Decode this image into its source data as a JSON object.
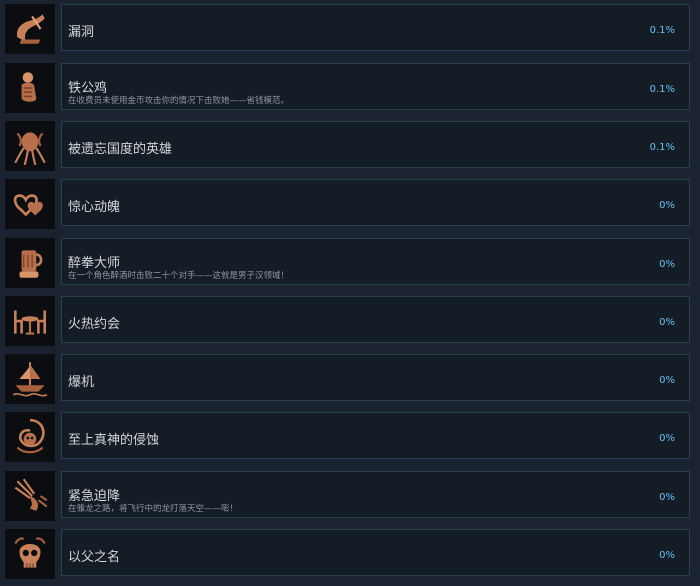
{
  "achievements": [
    {
      "title": "漏洞",
      "desc": "",
      "percent": "0.1%",
      "icon": "scroll-quill-icon"
    },
    {
      "title": "铁公鸡",
      "desc": "在收费员未使用金币攻击你的情况下击败她——省钱模范。",
      "percent": "0.1%",
      "icon": "coin-hand-icon"
    },
    {
      "title": "被遗忘国度的英雄",
      "desc": "",
      "percent": "0.1%",
      "icon": "mind-flayer-icon"
    },
    {
      "title": "惊心动魄",
      "desc": "",
      "percent": "0%",
      "icon": "hearts-icon"
    },
    {
      "title": "醉拳大师",
      "desc": "在一个角色醉酒时击败二十个对手——这就是男子汉领域！",
      "percent": "0%",
      "icon": "tankard-fist-icon"
    },
    {
      "title": "火热约会",
      "desc": "",
      "percent": "0%",
      "icon": "dinner-table-icon"
    },
    {
      "title": "爆机",
      "desc": "",
      "percent": "0%",
      "icon": "ship-icon"
    },
    {
      "title": "至上真神的侵蚀",
      "desc": "",
      "percent": "0%",
      "icon": "swirl-skull-icon"
    },
    {
      "title": "紧急迫降",
      "desc": "在雏龙之路，将飞行中的龙打落天空——嘭！",
      "percent": "0%",
      "icon": "falling-dragon-icon"
    },
    {
      "title": "以父之名",
      "desc": "",
      "percent": "0%",
      "icon": "skull-icon"
    }
  ],
  "colors": {
    "accent": "#66c0f4",
    "icon_bronze": "#c8805a"
  }
}
